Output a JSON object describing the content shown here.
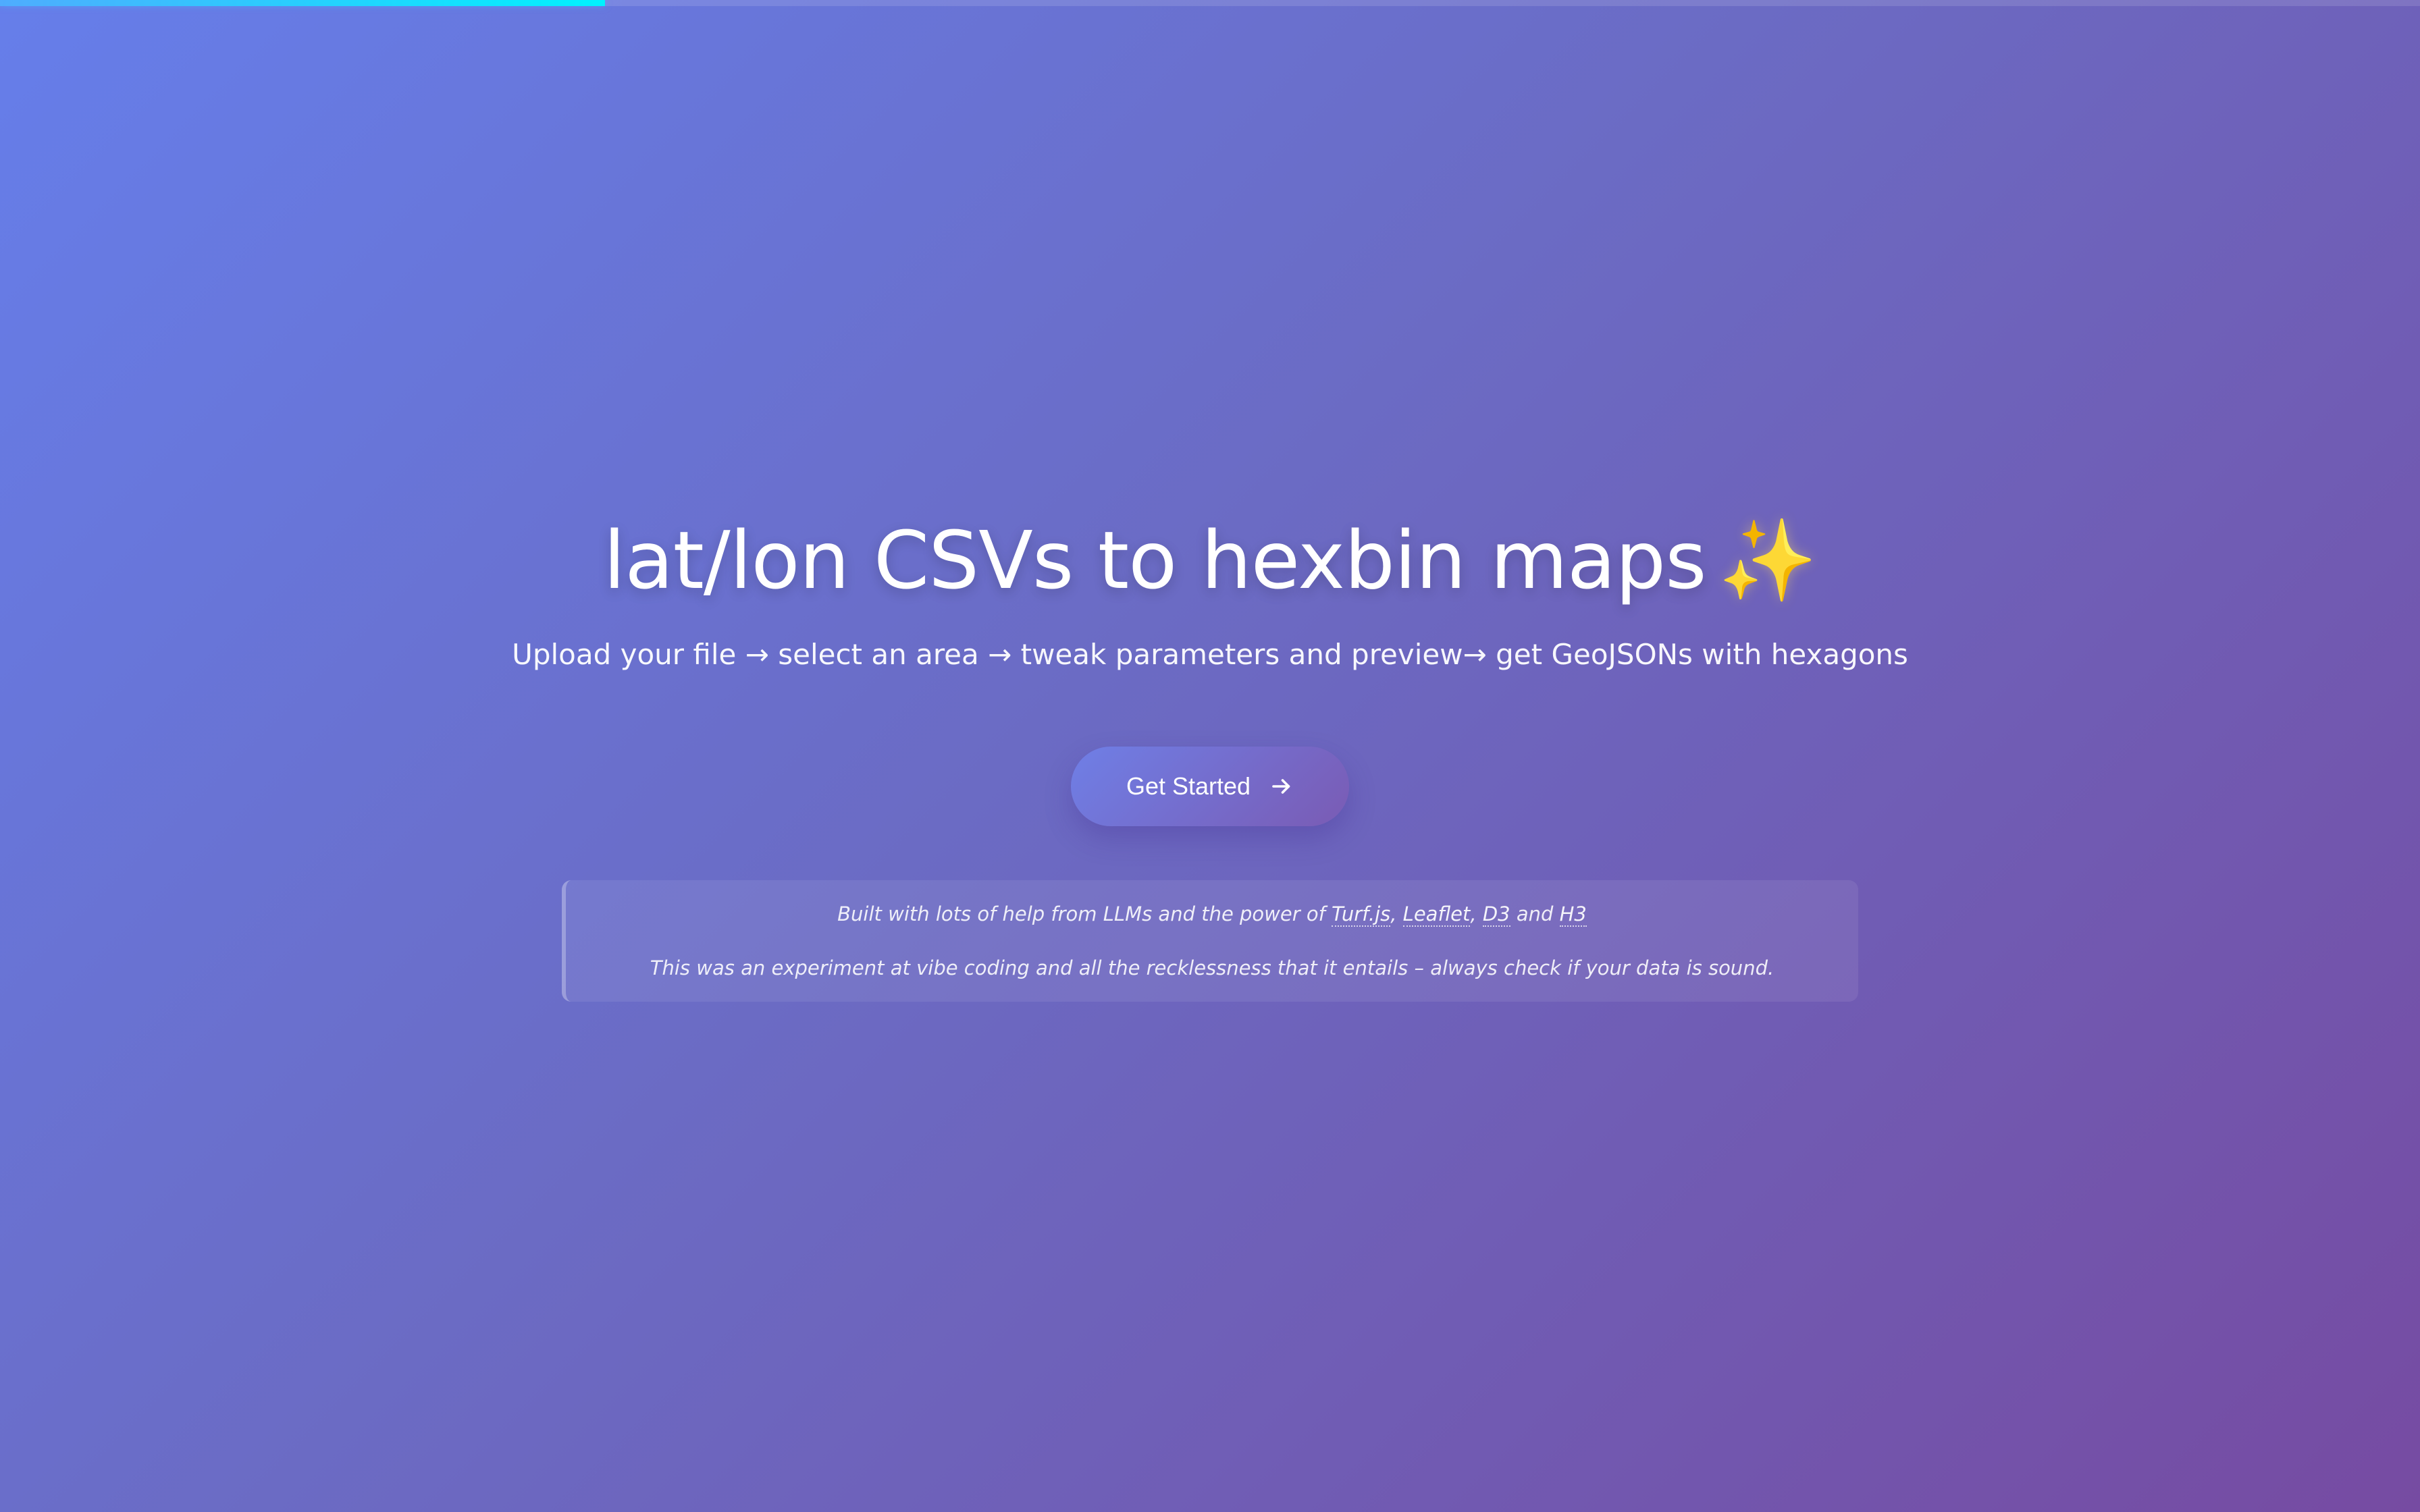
{
  "progress": {
    "fraction": 0.25
  },
  "hero": {
    "title": "lat/lon CSVs to hexbin maps",
    "title_emoji": "✨",
    "subtitle": "Upload your file → select an area → tweak parameters and preview→ get GeoJSONs with hexagons"
  },
  "cta": {
    "label": "Get Started",
    "icon": "arrow-right-icon"
  },
  "info": {
    "credits_prefix": "Built with lots of help from LLMs and the power of ",
    "links": [
      "Turf.js",
      "Leaflet",
      "D3",
      "H3"
    ],
    "sep_comma": ", ",
    "sep_and": " and ",
    "disclaimer": "This was an experiment at vibe coding and all the recklessness that it entails – always check if your data is sound."
  },
  "colors": {
    "gradient_start": "#667eea",
    "gradient_end": "#764ba2",
    "progress_fill": "#4facfe",
    "sparkle": "#f6d04d"
  }
}
